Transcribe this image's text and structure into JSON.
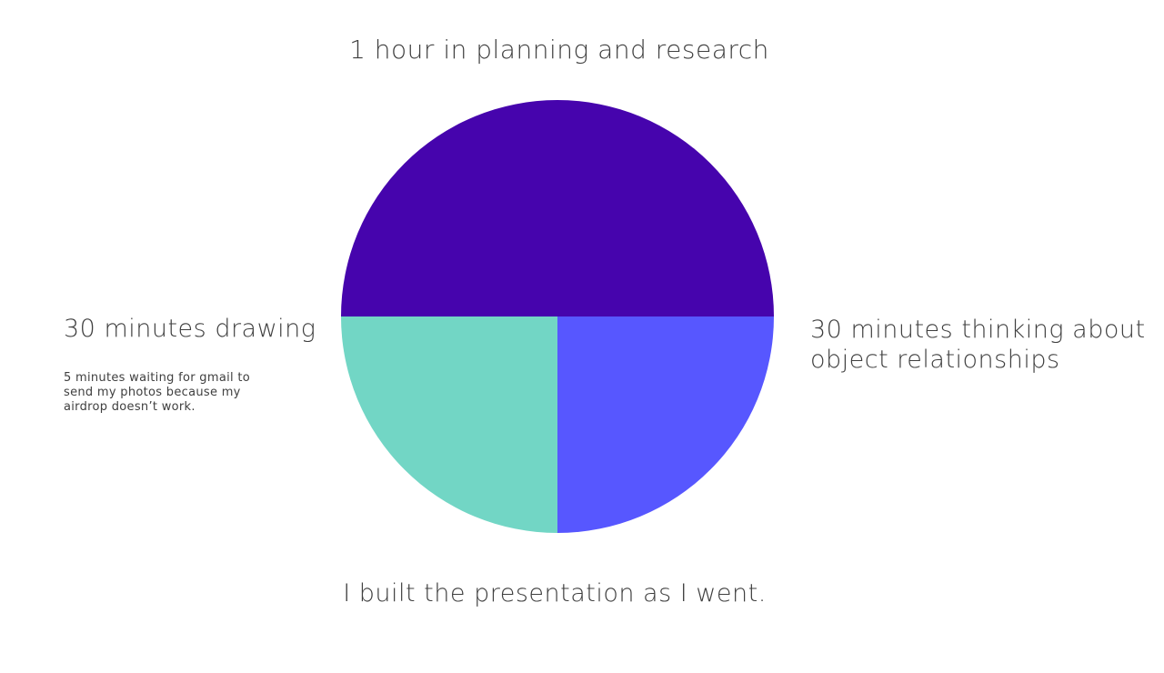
{
  "chart_data": {
    "type": "pie",
    "slices": [
      {
        "label": "1 hour in planning and research",
        "value": 60,
        "color": "#4604ad"
      },
      {
        "label": "30 minutes thinking about object relationships",
        "value": 30,
        "color": "#5757ff"
      },
      {
        "label": "30 minutes drawing",
        "value": 30,
        "color": "#72d6c5"
      }
    ],
    "annotations": [
      "5 minutes waiting for gmail to send my photos because my airdrop doesn’t work.",
      "I built the presentation as I went."
    ]
  }
}
